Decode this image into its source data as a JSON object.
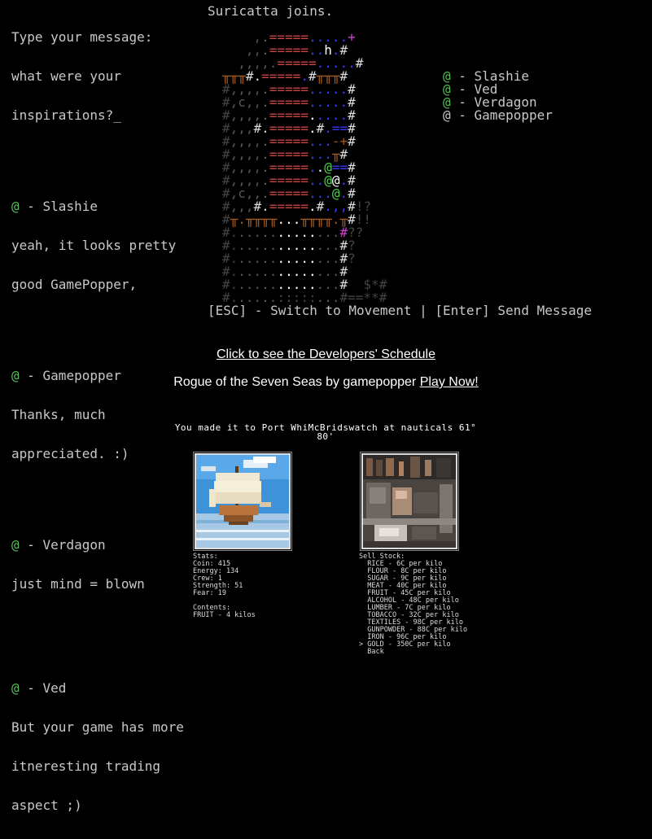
{
  "chat": {
    "prompt_lines": [
      "Type your message:",
      "what were your",
      "inspirations?_"
    ],
    "messages": [
      {
        "at": "@",
        "name": " - Slashie",
        "lines": [
          "yeah, it looks pretty",
          "good GamePopper,"
        ]
      },
      {
        "at": "@",
        "name": " - Gamepopper",
        "lines": [
          "Thanks, much",
          "appreciated. :)"
        ]
      },
      {
        "at": "@",
        "name": " - Verdagon",
        "lines": [
          "just mind = blown"
        ]
      },
      {
        "at": "@",
        "name": " - Ved",
        "lines": [
          "But your game has more",
          "itneresting trading",
          "aspect ;)"
        ]
      }
    ]
  },
  "header": {
    "join_message": "Suricatta joins."
  },
  "players": [
    {
      "at": "@",
      "name": " - Slashie"
    },
    {
      "at": "@",
      "name": " - Ved"
    },
    {
      "at": "@",
      "name": " - Verdagon"
    },
    {
      "at": "@",
      "name": " - Gamepopper"
    }
  ],
  "hint_bar": "[ESC] - Switch to Movement | [Enter] Send Message",
  "links": {
    "schedule": "Click to see the Developers' Schedule",
    "game_prefix": "Rogue of the Seven Seas by gamepopper ",
    "play_now": "Play Now!"
  },
  "trade": {
    "status_line1": "You made it to Port WhiMcBridswatch at nauticals 61°",
    "status_line2": "80'",
    "stats_header": "Stats:",
    "stats": [
      "Coin: 415",
      "Energy: 134",
      "Crew: 1",
      "Strength: 51",
      "Fear: 19"
    ],
    "contents_header": "Contents:",
    "contents": [
      "FRUIT - 4 kilos"
    ],
    "sell_header": "Sell Stock:",
    "sell_items": [
      "RICE - 6C per kilo",
      "FLOUR - 8C per kilo",
      "SUGAR - 9C per kilo",
      "MEAT - 40C per kilo",
      "FRUIT - 45C per kilo",
      "ALCOHOL - 48C per kilo",
      "LUMBER - 7C per kilo",
      "TOBACCO - 32C per kilo",
      "TEXTILES - 98C per kilo",
      "GUNPOWDER - 88C per kilo",
      "IRON - 96C per kilo",
      "GOLD - 350C per kilo",
      "Back"
    ],
    "cursor": ">",
    "cursor_index": 11
  },
  "colors": {
    "player_green": "#55c055",
    "background": "#000000",
    "text": "#c8c8c8"
  }
}
